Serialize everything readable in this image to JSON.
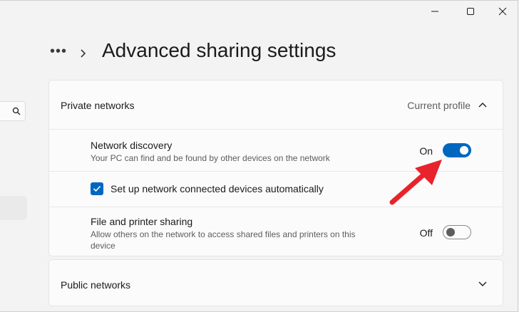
{
  "window": {
    "minimize_icon": "minimize-icon",
    "maximize_icon": "maximize-icon",
    "close_icon": "close-icon"
  },
  "header": {
    "breadcrumb_more": "•••",
    "title": "Advanced sharing settings"
  },
  "private_networks": {
    "title": "Private networks",
    "status": "Current profile",
    "expanded": true,
    "items": [
      {
        "title": "Network discovery",
        "description": "Your PC can find and be found by other devices on the network",
        "state_label": "On",
        "state": true
      },
      {
        "label": "Set up network connected devices automatically",
        "checked": true
      },
      {
        "title": "File and printer sharing",
        "description": "Allow others on the network to access shared files and printers on this device",
        "state_label": "Off",
        "state": false
      }
    ]
  },
  "public_networks": {
    "title": "Public networks",
    "expanded": false
  },
  "annotation": {
    "arrow_color": "#e8232b"
  },
  "colors": {
    "accent": "#0067c0",
    "background": "#f3f3f3",
    "card": "#fbfbfb"
  }
}
